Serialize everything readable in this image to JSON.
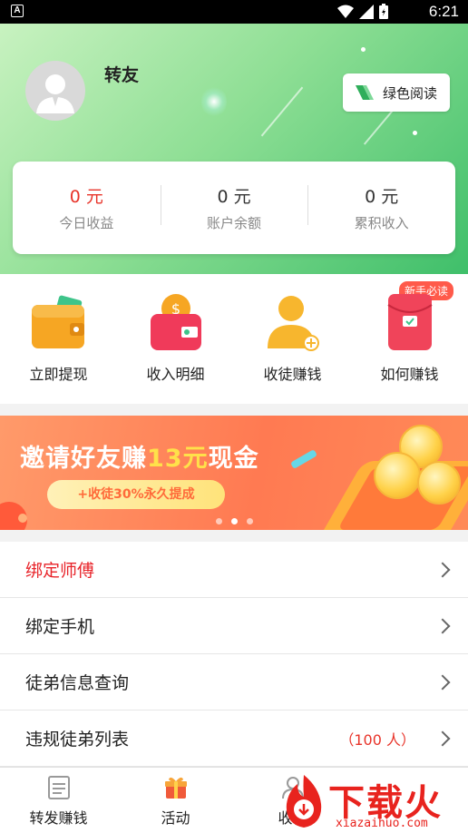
{
  "status_bar": {
    "time": "6:21",
    "notification_icon": "A"
  },
  "profile": {
    "username": "转友",
    "green_read_button": "绿色阅读"
  },
  "stats": [
    {
      "value": "0 元",
      "label": "今日收益"
    },
    {
      "value": "0 元",
      "label": "账户余额"
    },
    {
      "value": "0 元",
      "label": "累积收入"
    }
  ],
  "quick_actions": [
    {
      "label": "立即提现",
      "icon": "wallet-icon"
    },
    {
      "label": "收入明细",
      "icon": "money-bag-icon"
    },
    {
      "label": "收徒赚钱",
      "icon": "add-user-icon"
    },
    {
      "label": "如何赚钱",
      "icon": "red-envelope-icon",
      "badge": "新手必读"
    }
  ],
  "banner": {
    "title_prefix": "邀请好友赚",
    "title_highlight": "13元",
    "title_suffix": "现金",
    "pill": "+收徒30%永久提成"
  },
  "menu": [
    {
      "label": "绑定师傅",
      "highlight": true
    },
    {
      "label": "绑定手机"
    },
    {
      "label": "徒弟信息查询"
    },
    {
      "label": "违规徒弟列表",
      "count": "（100 人）"
    }
  ],
  "tabs": [
    {
      "label": "转发赚钱",
      "icon": "news-icon"
    },
    {
      "label": "活动",
      "icon": "gift-icon"
    },
    {
      "label": "收徒",
      "icon": "user-icon"
    },
    {
      "label": "",
      "icon": ""
    }
  ],
  "watermark": {
    "brand": "下载火",
    "domain": "xiazaihuo.com"
  },
  "colors": {
    "accent_red": "#e8342a",
    "header_green": "#3fbf6a",
    "banner_orange": "#ff7a52"
  }
}
